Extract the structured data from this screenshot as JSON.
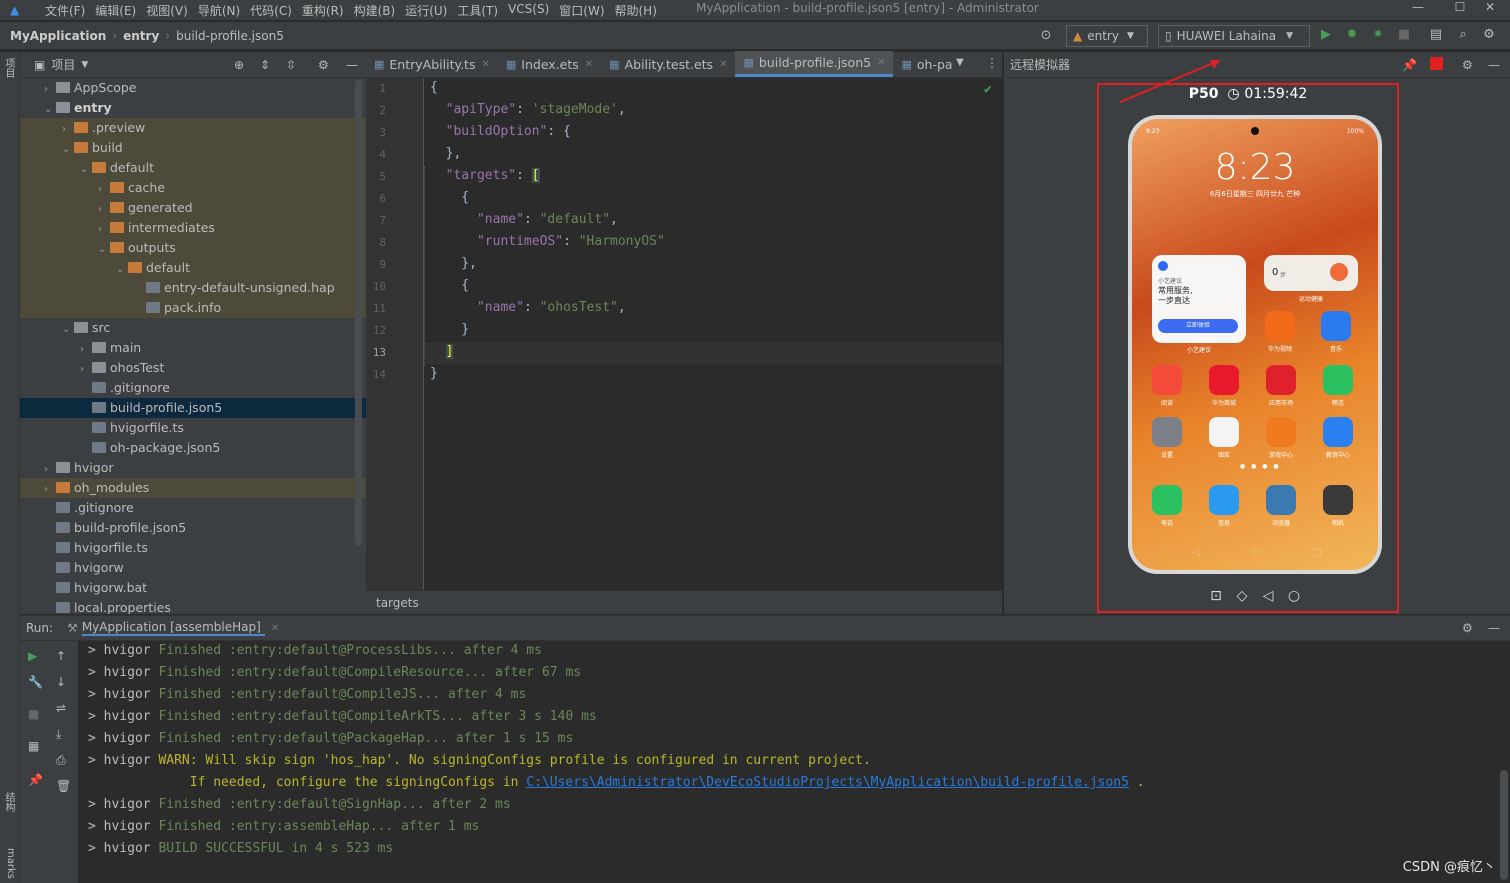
{
  "menubar": {
    "items": [
      "文件(F)",
      "编辑(E)",
      "视图(V)",
      "导航(N)",
      "代码(C)",
      "重构(R)",
      "构建(B)",
      "运行(U)",
      "工具(T)",
      "VCS(S)",
      "窗口(W)",
      "帮助(H)"
    ],
    "window_title": "MyApplication - build-profile.json5 [entry] - Administrator",
    "min": "—",
    "max": "☐",
    "close": "✕"
  },
  "navbar": {
    "crumbs": [
      "MyApplication",
      "entry",
      "build-profile.json5"
    ],
    "module_select": "entry",
    "device_select": "HUAWEI Lahaina"
  },
  "left_strip": {
    "project_label": "项目",
    "structure_label": "结构",
    "bookmarks_label": "marks"
  },
  "project": {
    "header": "项目",
    "tree": [
      {
        "label": "AppScope",
        "depth": 0,
        "arrow": "›",
        "icon": "folder-gray",
        "state": "normal"
      },
      {
        "label": "entry",
        "depth": 0,
        "arrow": "⌄",
        "icon": "folder-gray",
        "state": "normal",
        "bold": true
      },
      {
        "label": ".preview",
        "depth": 1,
        "arrow": "›",
        "icon": "folder-orange",
        "state": "hl"
      },
      {
        "label": "build",
        "depth": 1,
        "arrow": "⌄",
        "icon": "folder-orange",
        "state": "hl"
      },
      {
        "label": "default",
        "depth": 2,
        "arrow": "⌄",
        "icon": "folder-orange",
        "state": "hl"
      },
      {
        "label": "cache",
        "depth": 3,
        "arrow": "›",
        "icon": "folder-orange",
        "state": "hl"
      },
      {
        "label": "generated",
        "depth": 3,
        "arrow": "›",
        "icon": "folder-orange",
        "state": "hl"
      },
      {
        "label": "intermediates",
        "depth": 3,
        "arrow": "›",
        "icon": "folder-orange",
        "state": "hl"
      },
      {
        "label": "outputs",
        "depth": 3,
        "arrow": "⌄",
        "icon": "folder-orange",
        "state": "hl"
      },
      {
        "label": "default",
        "depth": 4,
        "arrow": "⌄",
        "icon": "folder-orange",
        "state": "hl"
      },
      {
        "label": "entry-default-unsigned.hap",
        "depth": 5,
        "arrow": "",
        "icon": "file",
        "state": "hl"
      },
      {
        "label": "pack.info",
        "depth": 5,
        "arrow": "",
        "icon": "file",
        "state": "hl"
      },
      {
        "label": "src",
        "depth": 1,
        "arrow": "⌄",
        "icon": "folder-gray",
        "state": "normal"
      },
      {
        "label": "main",
        "depth": 2,
        "arrow": "›",
        "icon": "folder-gray",
        "state": "normal"
      },
      {
        "label": "ohosTest",
        "depth": 2,
        "arrow": "›",
        "icon": "folder-gray",
        "state": "normal"
      },
      {
        "label": ".gitignore",
        "depth": 2,
        "arrow": "",
        "icon": "file",
        "state": "normal"
      },
      {
        "label": "build-profile.json5",
        "depth": 2,
        "arrow": "",
        "icon": "file",
        "state": "sel"
      },
      {
        "label": "hvigorfile.ts",
        "depth": 2,
        "arrow": "",
        "icon": "file",
        "state": "normal"
      },
      {
        "label": "oh-package.json5",
        "depth": 2,
        "arrow": "",
        "icon": "file",
        "state": "normal"
      },
      {
        "label": "hvigor",
        "depth": 0,
        "arrow": "›",
        "icon": "folder-gray",
        "state": "normal"
      },
      {
        "label": "oh_modules",
        "depth": 0,
        "arrow": "›",
        "icon": "folder-orange",
        "state": "hl"
      },
      {
        "label": ".gitignore",
        "depth": 0,
        "arrow": "",
        "icon": "file",
        "state": "normal"
      },
      {
        "label": "build-profile.json5",
        "depth": 0,
        "arrow": "",
        "icon": "file",
        "state": "normal"
      },
      {
        "label": "hvigorfile.ts",
        "depth": 0,
        "arrow": "",
        "icon": "file",
        "state": "normal"
      },
      {
        "label": "hvigorw",
        "depth": 0,
        "arrow": "",
        "icon": "file",
        "state": "normal"
      },
      {
        "label": "hvigorw.bat",
        "depth": 0,
        "arrow": "",
        "icon": "file",
        "state": "normal"
      },
      {
        "label": "local.properties",
        "depth": 0,
        "arrow": "",
        "icon": "file",
        "state": "normal"
      }
    ]
  },
  "tabs": [
    {
      "label": "EntryAbility.ts",
      "active": false
    },
    {
      "label": "Index.ets",
      "active": false
    },
    {
      "label": "Ability.test.ets",
      "active": false
    },
    {
      "label": "build-profile.json5",
      "active": true
    },
    {
      "label": "oh-pa",
      "active": false
    }
  ],
  "editor": {
    "current_line": 13,
    "hint": "targets",
    "lines": [
      {
        "n": "1",
        "html": "{"
      },
      {
        "n": "2",
        "html": "  <span class='k'>\"apiType\"</span>: <span class='s'>'stageMode'</span>,"
      },
      {
        "n": "3",
        "html": "  <span class='k'>\"buildOption\"</span>: {"
      },
      {
        "n": "4",
        "html": "  },"
      },
      {
        "n": "5",
        "html": "  <span class='k'>\"targets\"</span>: <span style='color:#ffef28;background:#3b514d'>[</span>"
      },
      {
        "n": "6",
        "html": "    {"
      },
      {
        "n": "7",
        "html": "      <span class='k'>\"name\"</span>: <span class='s'>\"default\"</span>,"
      },
      {
        "n": "8",
        "html": "      <span class='k'>\"runtimeOS\"</span>: <span class='s'>\"HarmonyOS\"</span>"
      },
      {
        "n": "9",
        "html": "    },"
      },
      {
        "n": "10",
        "html": "    {"
      },
      {
        "n": "11",
        "html": "      <span class='k'>\"name\"</span>: <span class='s'>\"ohosTest\"</span>,"
      },
      {
        "n": "12",
        "html": "    }"
      },
      {
        "n": "13",
        "html": "  <span style='color:#ffef28;background:#3b514d'>]</span>"
      },
      {
        "n": "14",
        "html": "}"
      }
    ]
  },
  "emulator": {
    "header": "远程模拟器",
    "device": "P50",
    "timer": "01:59:42",
    "clock": "8:23",
    "status_time": "8:23",
    "battery": "100%",
    "date": "6月6日星期三  四月廿九  芒种",
    "widget_title": "小艺建议",
    "widget_text1": "常用服务,",
    "widget_text2": "一步直达",
    "widget_btn": "立即体验",
    "widget_label": "小艺建议",
    "steps": "0",
    "steps_unit": "步",
    "steps_label": "运动健康",
    "apps": [
      {
        "label": "华为视频",
        "color": "#f06a1a"
      },
      {
        "label": "音乐",
        "color": "#2a7bf0"
      },
      {
        "label": "阅读",
        "color": "#f44a3a"
      },
      {
        "label": "华为商城",
        "color": "#e8192c"
      },
      {
        "label": "应用市场",
        "color": "#e0202a"
      },
      {
        "label": "畅连",
        "color": "#2bc060"
      },
      {
        "label": "设置",
        "color": "#7a7f88"
      },
      {
        "label": "图库",
        "color": "#f4f4f4"
      },
      {
        "label": "游戏中心",
        "color": "#f07a20"
      },
      {
        "label": "教育中心",
        "color": "#2a80f0"
      }
    ],
    "dock": [
      {
        "label": "电话",
        "color": "#2bc060"
      },
      {
        "label": "信息",
        "color": "#2a9af0"
      },
      {
        "label": "浏览器",
        "color": "#3a7ab0"
      },
      {
        "label": "相机",
        "color": "#3a3a3a"
      }
    ]
  },
  "run": {
    "label": "Run:",
    "tab": "MyApplication [assembleHap]",
    "lines": [
      {
        "html": "&gt; hvigor <span class='g'>Finished :entry:default@ProcessLibs... after 4 ms</span>"
      },
      {
        "html": "&gt; hvigor <span class='g'>Finished :entry:default@CompileResource... after 67 ms</span>"
      },
      {
        "html": "&gt; hvigor <span class='g'>Finished :entry:default@CompileJS... after 4 ms</span>"
      },
      {
        "html": "&gt; hvigor <span class='g'>Finished :entry:default@CompileArkTS... after 3 s 140 ms</span>"
      },
      {
        "html": "&gt; hvigor <span class='g'>Finished :entry:default@PackageHap... after 1 s 15 ms</span>"
      },
      {
        "html": "&gt; hvigor <span class='w'>WARN: Will skip sign 'hos_hap'. No signingConfigs profile is configured in current project.</span>"
      },
      {
        "html": "<span class='w'>             If needed, configure the signingConfigs in </span><span class='lnk'>C:\\Users\\Administrator\\DevEcoStudioProjects\\MyApplication\\build-profile.json5</span><span class='w'> .</span>"
      },
      {
        "html": "&gt; hvigor <span class='g'>Finished :entry:default@SignHap... after 2 ms</span>"
      },
      {
        "html": "&gt; hvigor <span class='g'>Finished :entry:assembleHap... after 1 ms</span>"
      },
      {
        "html": "&gt; hvigor <span class='g'>BUILD SUCCESSFUL in 4 s 523 ms</span>"
      }
    ]
  },
  "watermark": "CSDN @痕忆丶",
  "colors": {
    "accent": "#4a88c7",
    "highlight_box": "#e02020",
    "run_green": "#499c54"
  }
}
